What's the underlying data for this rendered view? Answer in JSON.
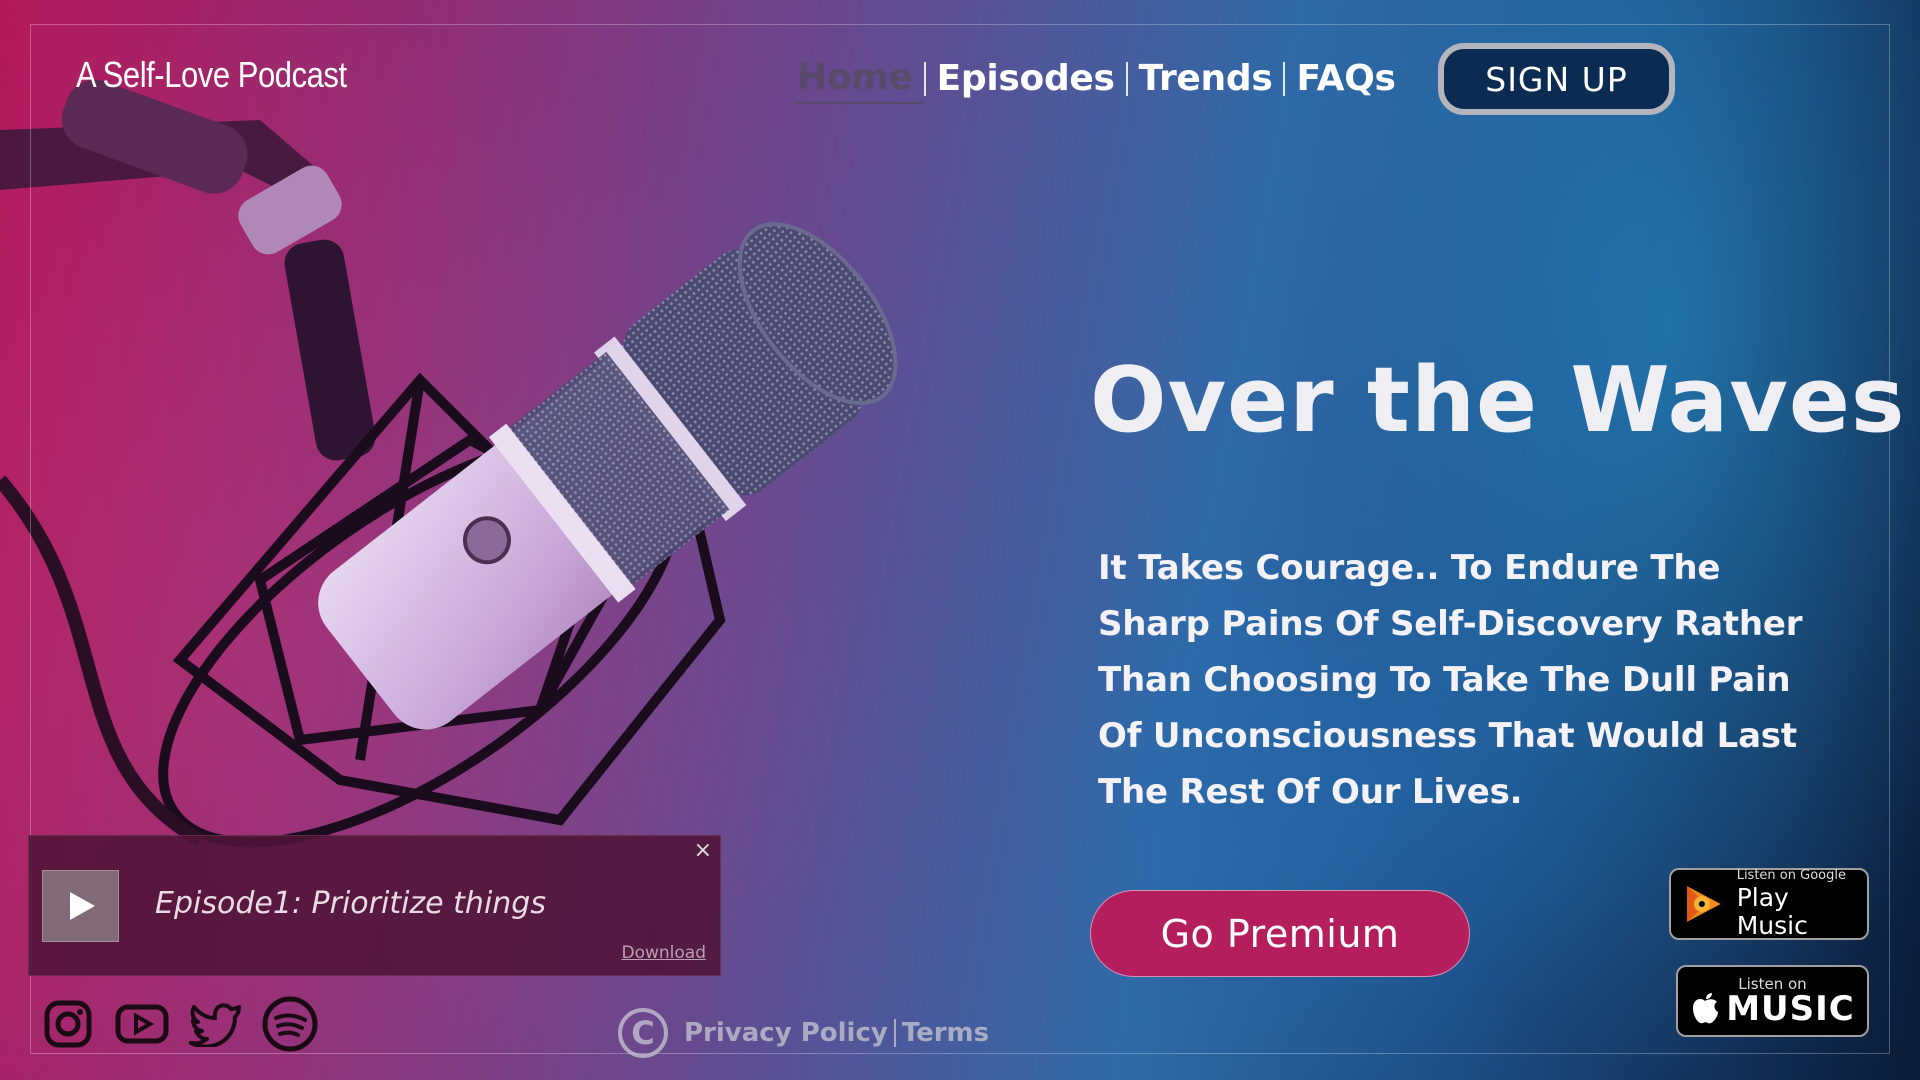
{
  "header": {
    "brand": "A Self-Love Podcast",
    "nav": [
      {
        "label": "Home",
        "active": true
      },
      {
        "label": "Episodes",
        "active": false
      },
      {
        "label": "Trends",
        "active": false
      },
      {
        "label": "FAQs",
        "active": false
      }
    ],
    "signup_label": "SIGN UP"
  },
  "hero": {
    "title": "Over the Waves",
    "text": "It Takes Courage.. To Endure The Sharp Pains Of Self-Discovery Rather Than Choosing To Take The Dull Pain Of Unconsciousness That Would Last The Rest Of Our Lives.",
    "cta_label": "Go Premium"
  },
  "badges": {
    "google_play": {
      "small": "Listen on Google",
      "big": "Play Music"
    },
    "apple_music": {
      "small": "Listen on",
      "big": "MUSIC"
    }
  },
  "player": {
    "episode_title": "Episode1: Prioritize things",
    "download_label": "Download",
    "close_glyph": "×"
  },
  "socials": [
    "instagram-icon",
    "youtube-icon",
    "twitter-icon",
    "spotify-icon"
  ],
  "footer": {
    "copyright_glyph": "C",
    "privacy_label": "Privacy Policy",
    "terms_label": "Terms"
  },
  "colors": {
    "accent": "#b51e5d",
    "signup_bg": "#0c2b52",
    "nav_active": "#5a4a6a"
  }
}
